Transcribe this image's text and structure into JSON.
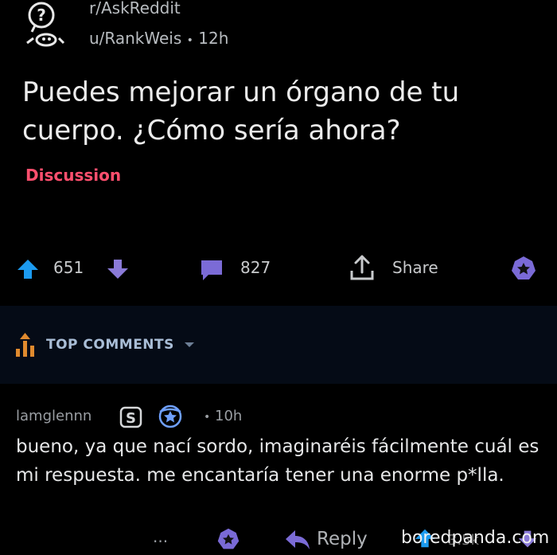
{
  "post": {
    "subreddit": "r/AskReddit",
    "author": "u/RankWeis",
    "separator": "•",
    "age": "12h",
    "title": "Puedes mejorar un órgano de tu cuerpo. ¿Cómo sería ahora?",
    "flair": "Discussion"
  },
  "actions": {
    "upvotes": "651",
    "comments": "827",
    "share_label": "Share"
  },
  "comments_header": {
    "label": "TOP COMMENTS"
  },
  "comment": {
    "username": "lamglennn",
    "badge_letter": "S",
    "separator": "•",
    "age": "10h",
    "body": "bueno, ya que nací sordo, imaginaréis fácilmente cuál es mi respuesta. me encantaría tener una enorme  p*lla.",
    "more": "...",
    "reply_label": "Reply",
    "vote_partial": "3.5k"
  },
  "watermark": "boredpanda.com",
  "colors": {
    "upvote": "#1c9bf0",
    "downvote": "#8a7ad8",
    "comment": "#7b6bd6",
    "award": "#7a6ad6",
    "flair": "#ff4f6e",
    "background": "#000000"
  },
  "icons": {
    "subreddit_avatar": "askreddit-snoo-icon",
    "upvote": "arrow-up-icon",
    "downvote": "arrow-down-icon",
    "comments": "speech-bubble-icon",
    "share": "share-icon",
    "award": "award-icon"
  }
}
